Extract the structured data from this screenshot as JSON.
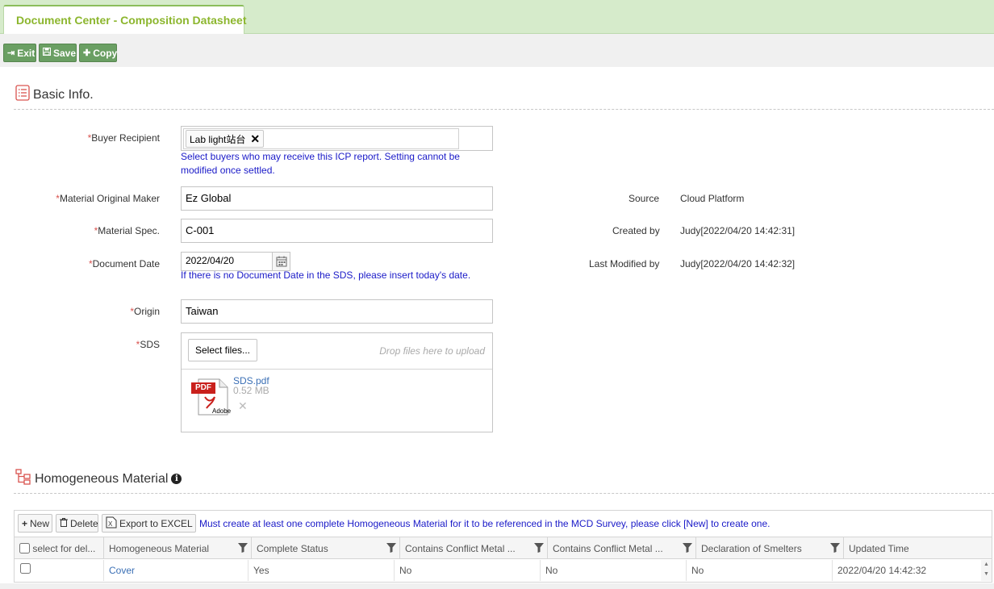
{
  "tab": {
    "title": "Document Center - Composition Datasheet"
  },
  "toolbar": {
    "exit": "Exit",
    "save": "Save",
    "copy": "Copy"
  },
  "basic": {
    "title": "Basic Info.",
    "buyer_label": "Buyer Recipient",
    "buyer_tag": "Lab light站台",
    "buyer_hint": "Select buyers who may receive this ICP report. Setting cannot be modified once settled.",
    "maker_label": "Material Original Maker",
    "maker_value": "Ez Global",
    "spec_label": "Material Spec.",
    "spec_value": "C-001",
    "date_label": "Document Date",
    "date_value": "2022/04/20",
    "date_hint": "If there is no Document Date in the SDS, please insert today's date.",
    "origin_label": "Origin",
    "origin_value": "Taiwan",
    "sds_label": "SDS",
    "select_files": "Select files...",
    "drop_hint": "Drop files here to upload",
    "file_name": "SDS.pdf",
    "file_size": "0.52 MB",
    "pdf_badge": "PDF",
    "adobe_label": "Adobe",
    "required_mark": "*",
    "source_label": "Source",
    "source_value": "Cloud Platform",
    "created_label": "Created by",
    "created_value": "Judy[2022/04/20 14:42:31]",
    "modified_label": "Last Modified by",
    "modified_value": "Judy[2022/04/20 14:42:32]"
  },
  "homog": {
    "title": "Homogeneous Material",
    "new_btn": "New",
    "delete_btn": "Delete",
    "export_btn": "Export to EXCEL",
    "note": "Must create at least one complete Homogeneous Material for it to be referenced in the MCD Survey, please click [New] to create one.",
    "columns": [
      "select for del...",
      "Homogeneous Material",
      "Complete Status",
      "Contains Conflict Metal ...",
      "Contains Conflict Metal ...",
      "Declaration of Smelters",
      "Updated Time"
    ],
    "row": {
      "material": "Cover",
      "complete": "Yes",
      "conflict1": "No",
      "conflict2": "No",
      "smelters": "No",
      "updated": "2022/04/20 14:42:32"
    }
  },
  "colors": {
    "accent_green": "#8cb62e",
    "button_green": "#6a9f63",
    "hint_blue": "#1a1ac8",
    "required_red": "#d9534f"
  }
}
